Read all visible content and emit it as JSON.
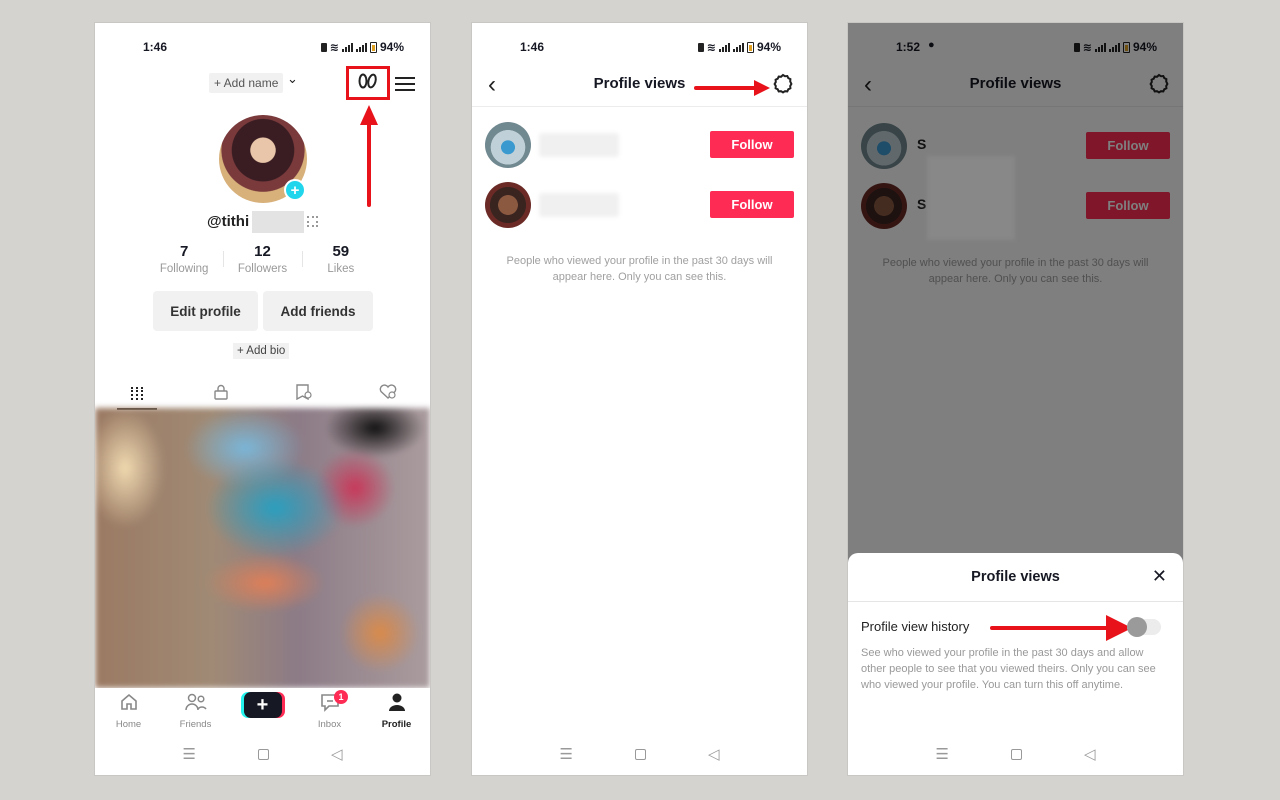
{
  "panel1": {
    "status": {
      "time": "1:46",
      "battery": "94%"
    },
    "header": {
      "add_name": "+ Add name",
      "chevron": "⌄"
    },
    "username": "@tithi",
    "stats": [
      {
        "value": "7",
        "label": "Following"
      },
      {
        "value": "12",
        "label": "Followers"
      },
      {
        "value": "59",
        "label": "Likes"
      }
    ],
    "buttons": {
      "edit_profile": "Edit profile",
      "add_friends": "Add friends"
    },
    "add_bio": "+ Add bio",
    "tabs": [
      "videos-grid",
      "private",
      "reposts",
      "liked"
    ],
    "bottom_nav": [
      {
        "label": "Home",
        "icon": "⌂"
      },
      {
        "label": "Friends",
        "icon": "👥"
      },
      {
        "label": "",
        "icon": "+"
      },
      {
        "label": "Inbox",
        "icon": "💬",
        "badge": "1"
      },
      {
        "label": "Profile",
        "icon": "👤"
      }
    ],
    "footprint_icon": "ꝊꝊ"
  },
  "panel2": {
    "status": {
      "time": "1:46",
      "battery": "94%"
    },
    "title": "Profile views",
    "viewers": [
      {
        "follow_label": "Follow"
      },
      {
        "follow_label": "Follow"
      }
    ],
    "info": "People who viewed your profile in the past 30 days will appear here. Only you can see this."
  },
  "panel3": {
    "status": {
      "time": "1:52",
      "battery": "94%"
    },
    "title": "Profile views",
    "viewers": [
      {
        "initial": "S",
        "follow_label": "Follow"
      },
      {
        "initial": "S",
        "follow_label": "Follow"
      }
    ],
    "info": "People who viewed your profile in the past 30 days will appear here. Only you can see this.",
    "sheet": {
      "title": "Profile views",
      "close": "✕",
      "setting_label": "Profile view history",
      "toggle_on": false,
      "description": "See who viewed your profile in the past 30 days and allow other people to see that you viewed theirs. Only you can see who viewed your profile. You can turn this off anytime."
    }
  },
  "colors": {
    "follow": "#fe2c55",
    "annotation": "#e8121b",
    "accent_cyan": "#20d5ec"
  }
}
